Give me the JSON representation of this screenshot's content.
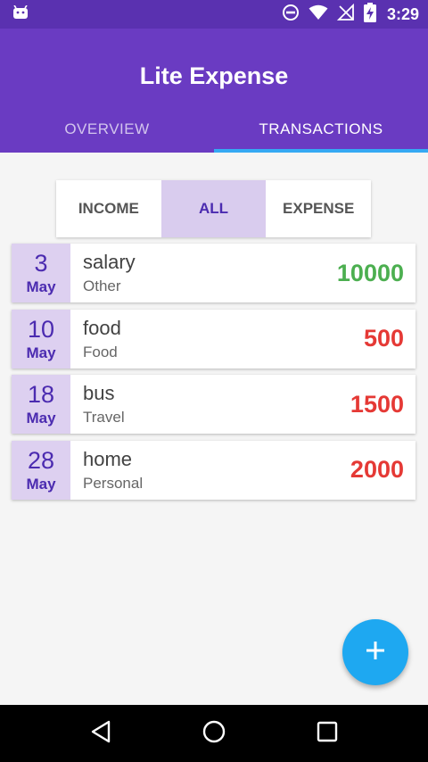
{
  "status_bar": {
    "time": "3:29"
  },
  "app": {
    "title": "Lite Expense"
  },
  "tabs": [
    {
      "label": "OVERVIEW",
      "selected": false
    },
    {
      "label": "TRANSACTIONS",
      "selected": true
    }
  ],
  "filter": {
    "income": "INCOME",
    "all": "ALL",
    "expense": "EXPENSE",
    "selected": "ALL"
  },
  "transactions": [
    {
      "day": "3",
      "month": "May",
      "name": "salary",
      "category": "Other",
      "amount": "10000",
      "type": "income"
    },
    {
      "day": "10",
      "month": "May",
      "name": "food",
      "category": "Food",
      "amount": "500",
      "type": "expense"
    },
    {
      "day": "18",
      "month": "May",
      "name": "bus",
      "category": "Travel",
      "amount": "1500",
      "type": "expense"
    },
    {
      "day": "28",
      "month": "May",
      "name": "home",
      "category": "Personal",
      "amount": "2000",
      "type": "expense"
    }
  ],
  "colors": {
    "primary": "#6a3bc2",
    "status_bar": "#5a31b0",
    "accent": "#1ea8f1",
    "income": "#4caf50",
    "expense": "#e53935",
    "date_bg": "#ddd0f0",
    "date_text": "#4b2bb0"
  },
  "icons": {
    "status_left": "android-icon",
    "dnd": "do-not-disturb-icon",
    "wifi": "wifi-icon",
    "signal": "no-signal-icon",
    "battery": "battery-charging-icon",
    "fab": "plus-icon",
    "nav_back": "back-triangle-icon",
    "nav_home": "home-circle-icon",
    "nav_recents": "recents-square-icon"
  }
}
